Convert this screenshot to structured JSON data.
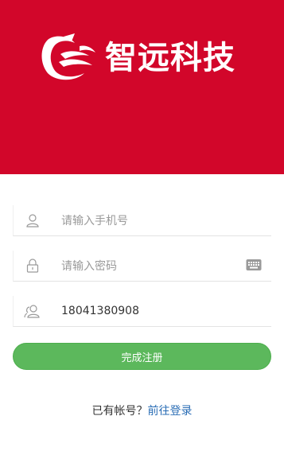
{
  "brand": {
    "name": "智远科技",
    "banner_color": "#d2062a"
  },
  "form": {
    "phone": {
      "placeholder": "请输入手机号",
      "icon": "user-icon"
    },
    "password": {
      "placeholder": "请输入密码",
      "icon": "lock-icon",
      "toggle_icon": "keyboard-icon"
    },
    "referrer": {
      "value": "18041380908",
      "icon": "users-icon"
    }
  },
  "submit": {
    "label": "完成注册",
    "color": "#5cb85c"
  },
  "footer": {
    "prompt": "已有帐号？",
    "link": "前往登录",
    "link_color": "#2a6db5"
  }
}
